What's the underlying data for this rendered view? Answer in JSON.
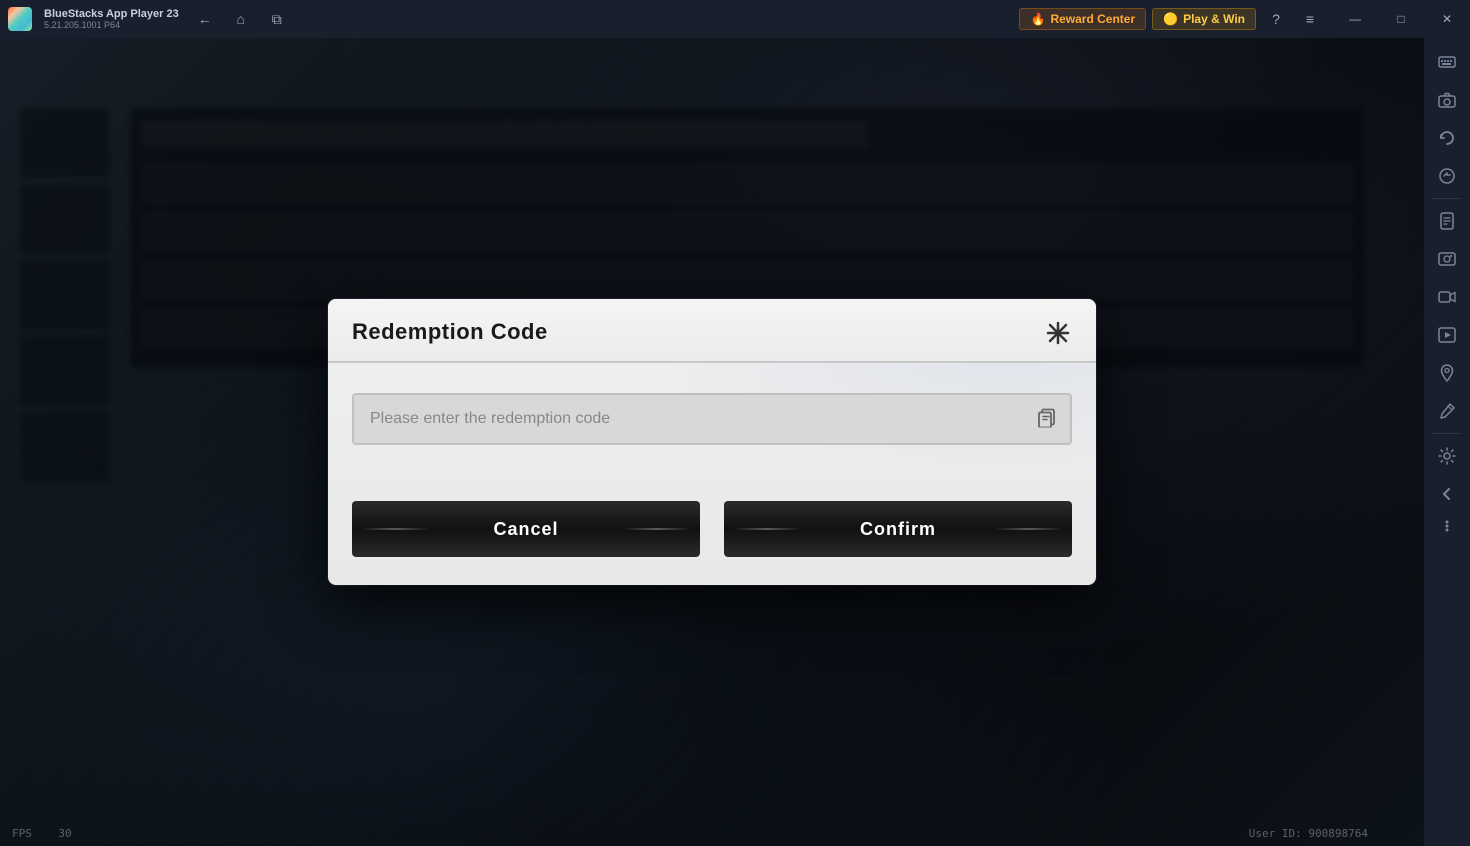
{
  "titlebar": {
    "app_name": "BlueStacks App Player 23",
    "version": "5.21.205.1001 P64",
    "back_btn": "←",
    "home_btn": "⌂",
    "recent_btn": "⧉",
    "reward_center_label": "Reward Center",
    "play_win_label": "Play & Win",
    "help_icon": "?",
    "menu_icon": "≡",
    "minimize_icon": "—",
    "maximize_icon": "□",
    "close_icon": "✕"
  },
  "sidebar": {
    "icons": [
      {
        "name": "keyboard-icon",
        "glyph": "⌨"
      },
      {
        "name": "camera-icon",
        "glyph": "📷"
      },
      {
        "name": "rotate-icon",
        "glyph": "↻"
      },
      {
        "name": "replay-icon",
        "glyph": "⟳"
      },
      {
        "name": "android-icon",
        "glyph": "🤖"
      },
      {
        "name": "screenshot-icon",
        "glyph": "📸"
      },
      {
        "name": "record-icon",
        "glyph": "⏺"
      },
      {
        "name": "media-icon",
        "glyph": "🖼"
      },
      {
        "name": "location-icon",
        "glyph": "📍"
      },
      {
        "name": "brush-icon",
        "glyph": "🖌"
      },
      {
        "name": "gear-icon",
        "glyph": "⚙"
      },
      {
        "name": "arrow-left-icon",
        "glyph": "←"
      },
      {
        "name": "more-icon",
        "glyph": "•••"
      }
    ]
  },
  "modal": {
    "title": "Redemption Code",
    "close_icon_char": "✕",
    "input_placeholder": "Please enter the redemption code",
    "paste_icon": "⧉",
    "cancel_label": "Cancel",
    "confirm_label": "Confirm"
  },
  "game": {
    "fps_label": "FPS",
    "fps_value": "30",
    "user_id_label": "User ID: 900898764"
  }
}
